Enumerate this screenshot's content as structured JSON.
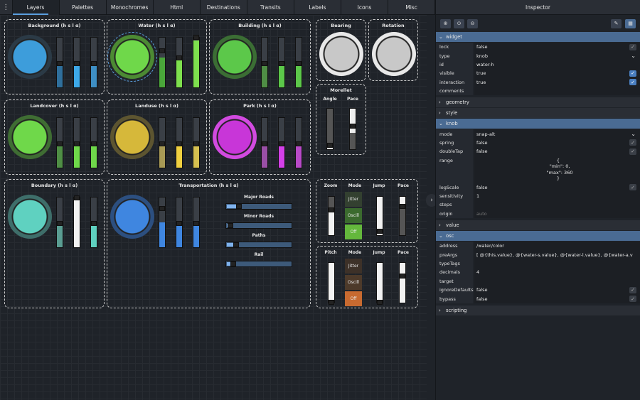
{
  "topbar": {
    "menu_icon": "⋮",
    "tabs": [
      "Layers",
      "Palettes",
      "Monochromes",
      "Html",
      "Destinations",
      "Transits",
      "Labels",
      "Icons",
      "Misc"
    ]
  },
  "panels": {
    "background": "Background (h s l α)",
    "water": "Water (h s l α)",
    "building": "Building (h s l α)",
    "bearing": "Bearing",
    "rotation": "Rotation",
    "landcover": "Landcover (h s l α)",
    "landuse": "Landuse (h s l α)",
    "park": "Park (h s l α)",
    "morellet": "Morellet",
    "angle": "Angle",
    "pace": "Pace",
    "boundary": "Boundary (h s l α)",
    "transportation": "Transportation (h s l α)",
    "major_roads": "Major Roads",
    "minor_roads": "Minor Roads",
    "paths": "Paths",
    "rail": "Rail",
    "zoom": "Zoom",
    "mode": "Mode",
    "jump": "Jump",
    "pace2": "Pace",
    "pitch": "Pitch",
    "mode2": "Mode",
    "jump2": "Jump",
    "pace3": "Pace",
    "jitter": "Jitter",
    "oscill": "Oscill",
    "off": "Off",
    "jitter2": "Jitter",
    "oscill2": "Oscill",
    "off2": "Off"
  },
  "inspector": {
    "title": "Inspector",
    "sections": {
      "widget": "widget",
      "geometry": "geometry",
      "style": "style",
      "knob": "knob",
      "value": "value",
      "osc": "osc",
      "scripting": "scripting"
    },
    "widget": [
      {
        "k": "lock",
        "v": "false"
      },
      {
        "k": "type",
        "v": "knob"
      },
      {
        "k": "id",
        "v": "water-h"
      },
      {
        "k": "visible",
        "v": "true"
      },
      {
        "k": "interaction",
        "v": "true"
      },
      {
        "k": "comments",
        "v": ""
      }
    ],
    "knob": [
      {
        "k": "mode",
        "v": "snap-alt"
      },
      {
        "k": "spring",
        "v": "false"
      },
      {
        "k": "doubleTap",
        "v": "false"
      },
      {
        "k": "range",
        "v1": "{",
        "v2": "  \"min\": 0,",
        "v3": "  \"max\": 360",
        "v4": "}"
      },
      {
        "k": "logScale",
        "v": "false"
      },
      {
        "k": "sensitivity",
        "v": "1"
      },
      {
        "k": "steps",
        "v": ""
      },
      {
        "k": "origin",
        "v": "auto"
      }
    ],
    "osc": [
      {
        "k": "address",
        "v": "/water/color"
      },
      {
        "k": "preArgs",
        "v": "[ @{this.value}, @{water-s.value}, @{water-l.value}, @{water-a.v"
      },
      {
        "k": "typeTags",
        "v": ""
      },
      {
        "k": "decimals",
        "v": "4"
      },
      {
        "k": "target",
        "v": ""
      },
      {
        "k": "ignoreDefaults",
        "v": "false"
      },
      {
        "k": "bypass",
        "v": "false"
      }
    ]
  },
  "colors": {
    "accent": "#4a6b93",
    "water": "#6fd84a",
    "background": "#3d9ddb",
    "park": "#c836d8",
    "landuse": "#d6b83a",
    "boundary": "#5fd1c0",
    "transport": "#3f86e0"
  }
}
